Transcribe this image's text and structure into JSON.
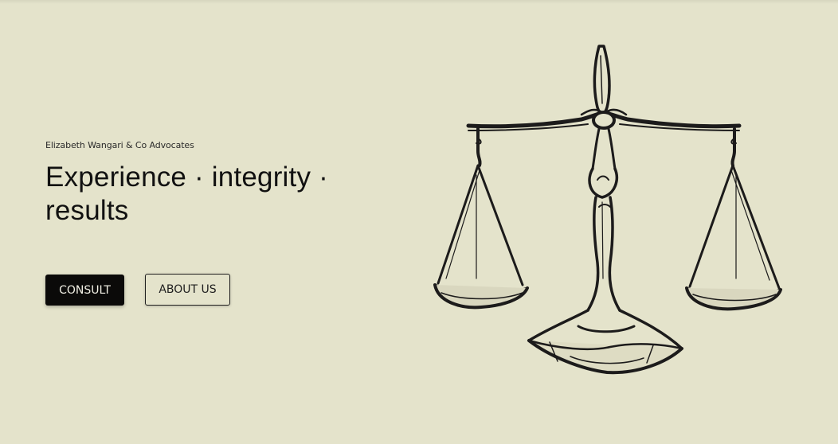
{
  "hero": {
    "firm_name": "Elizabeth Wangari & Co Advocates",
    "tagline": "Experience · integrity · results"
  },
  "buttons": {
    "consult_label": "CONSULT",
    "about_label": "ABOUT US"
  },
  "illustration": {
    "icon": "scales-of-justice-icon"
  },
  "colors": {
    "background": "#e4e3cb",
    "primary_button": "#0b0a09",
    "ink": "#141414"
  }
}
